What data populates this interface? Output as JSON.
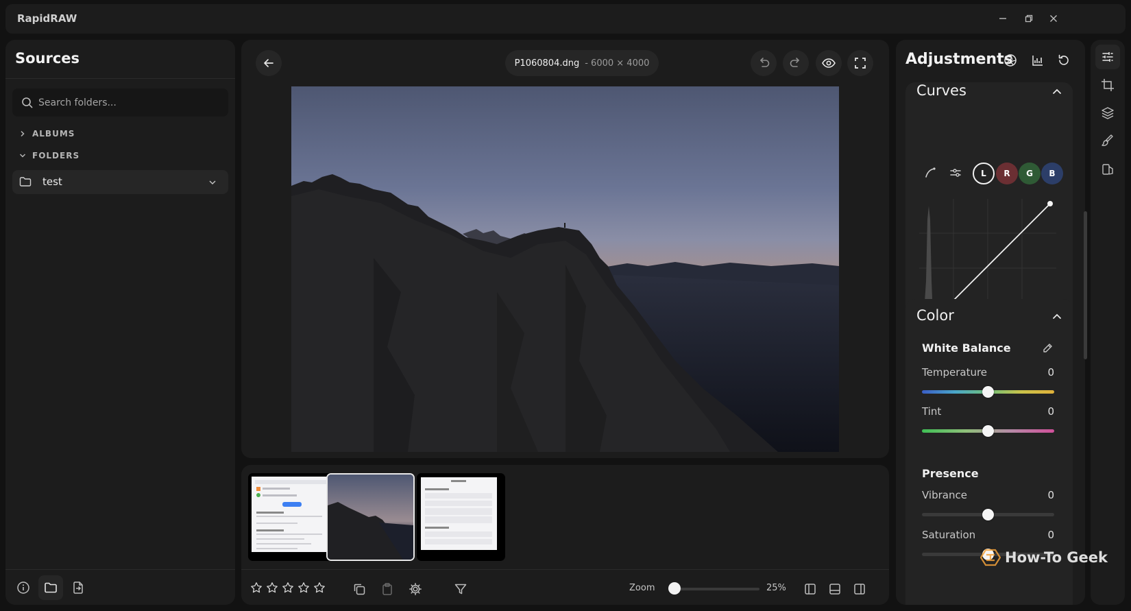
{
  "app": {
    "title": "RapidRAW"
  },
  "colors": {
    "window_bg": "#121212",
    "panel_bg": "#1c1c1c",
    "card_bg": "#232323",
    "control_bg": "#262626",
    "red_channel": "#6b2f33",
    "green_channel": "#2f5a35",
    "blue_channel": "#2c3e68"
  },
  "icons": {
    "window": [
      "minimize-icon",
      "restore-icon",
      "close-icon"
    ],
    "sources_bottom": [
      "info-icon",
      "folder-icon",
      "export-icon"
    ],
    "viewer_toolbar": [
      "back-arrow-icon",
      "undo-icon",
      "redo-icon",
      "eye-icon",
      "fullscreen-icon"
    ],
    "filmstrip_tools": [
      "copy-icon",
      "paste-icon",
      "settings-gear-icon",
      "filter-icon"
    ],
    "layout_toggles": [
      "left-panel-icon",
      "bottom-panel-icon",
      "right-panel-icon"
    ],
    "adjustment_header": [
      "aperture-icon",
      "histogram-icon",
      "reset-icon"
    ],
    "side_toolbar": [
      "sliders-icon",
      "crop-icon",
      "layers-icon",
      "brush-icon",
      "presets-icon"
    ]
  },
  "sources": {
    "title": "Sources",
    "search": {
      "placeholder": "Search folders...",
      "value": ""
    },
    "sections": {
      "albums": "ALBUMS",
      "folders": "FOLDERS"
    },
    "folder": {
      "label": "test"
    }
  },
  "viewer": {
    "file_name": "P1060804.dng",
    "dimensions": "- 6000 × 4000"
  },
  "filmstrip": {
    "rating": {
      "max": 5,
      "value": 0
    },
    "zoom": {
      "label": "Zoom",
      "value_text": "25%",
      "level": 0.25
    },
    "selected_index": 1,
    "count": 3
  },
  "adjustments": {
    "title": "Adjustments",
    "curves": {
      "title": "Curves",
      "channels": [
        "L",
        "R",
        "G",
        "B"
      ],
      "active_channel": "L"
    },
    "color": {
      "title": "Color",
      "white_balance": {
        "heading": "White Balance",
        "temperature": {
          "label": "Temperature",
          "value": "0"
        },
        "tint": {
          "label": "Tint",
          "value": "0"
        }
      },
      "presence": {
        "heading": "Presence",
        "vibrance": {
          "label": "Vibrance",
          "value": "0"
        },
        "saturation": {
          "label": "Saturation",
          "value": "0"
        }
      }
    }
  },
  "watermark": {
    "text": "How-To Geek"
  }
}
